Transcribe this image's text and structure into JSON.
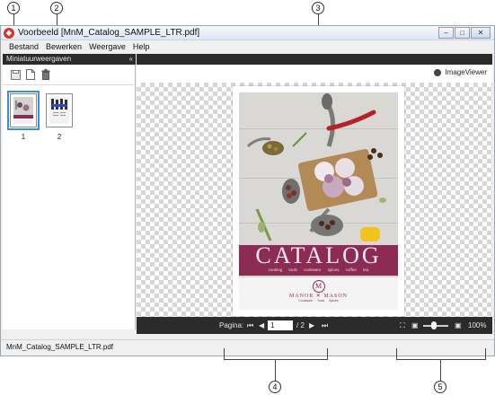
{
  "window": {
    "title": "Voorbeeld [MnM_Catalog_SAMPLE_LTR.pdf]",
    "buttons": [
      "–",
      "□",
      "✕"
    ]
  },
  "menu": {
    "items": [
      "Bestand",
      "Bewerken",
      "Weergave",
      "Help"
    ]
  },
  "left_panel": {
    "header": "Miniatuurweergaven",
    "collapse": "«",
    "toolbar_icons": [
      "save-icon",
      "new-page-icon",
      "delete-icon"
    ],
    "thumbnails": [
      {
        "label": "1",
        "selected": true
      },
      {
        "label": "2",
        "selected": false
      }
    ]
  },
  "viewer": {
    "brand_label": "ImageViewer",
    "page_label": "Pagina:",
    "page_value": "1",
    "page_total": "/ 2",
    "zoom": "100%",
    "cover": {
      "title": "CATALOG",
      "tags": "cooking tools  cookware  spices  coffee  tea",
      "logo_letter": "M",
      "brand": "MANOR ✕ MASON",
      "brand_sub": "Cookware  Tools  Spices"
    }
  },
  "statusbar": {
    "filename": "MnM_Catalog_SAMPLE_LTR.pdf"
  },
  "callouts": [
    "1",
    "2",
    "3",
    "4",
    "5"
  ],
  "colors": {
    "accent": "#8c2b54",
    "toolbar": "#2b2b2b",
    "selection": "#3b8ed9"
  }
}
